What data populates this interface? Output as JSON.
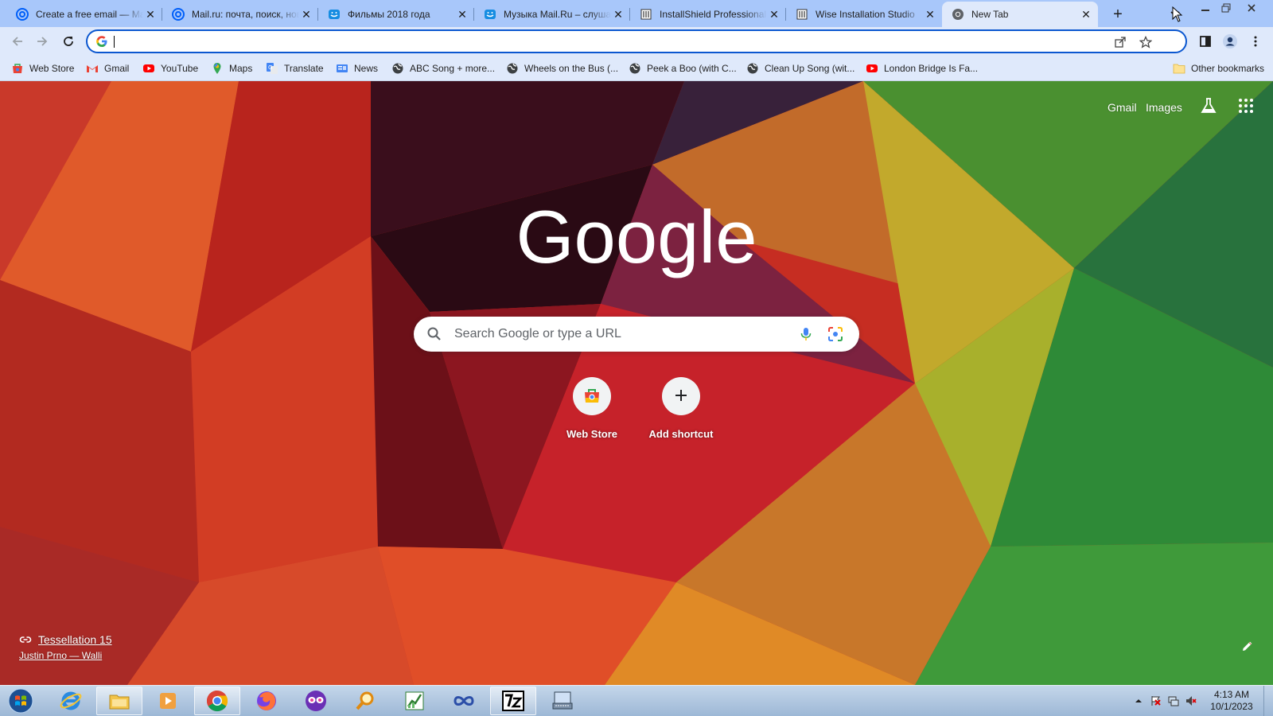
{
  "browser": {
    "tabs": [
      {
        "title": "Create a free email — Mail.ru",
        "favicon": "mailru-at-icon",
        "active": false
      },
      {
        "title": "Mail.ru: почта, поиск, новости",
        "favicon": "mailru-at-icon",
        "active": false
      },
      {
        "title": "Фильмы 2018 года",
        "favicon": "mailru-movies-icon",
        "active": false
      },
      {
        "title": "Музыка Mail.Ru – слушать",
        "favicon": "mailru-music-icon",
        "active": false
      },
      {
        "title": "InstallShield Professional",
        "favicon": "document-icon",
        "active": false
      },
      {
        "title": "Wise Installation Studio",
        "favicon": "document-icon",
        "active": false
      },
      {
        "title": "New Tab",
        "favicon": "chrome-icon",
        "active": true
      }
    ],
    "omnibox": {
      "value": "",
      "placeholder": ""
    },
    "bookmarks": [
      {
        "label": "Web Store",
        "icon": "webstore-icon"
      },
      {
        "label": "Gmail",
        "icon": "gmail-icon"
      },
      {
        "label": "YouTube",
        "icon": "youtube-icon"
      },
      {
        "label": "Maps",
        "icon": "maps-icon"
      },
      {
        "label": "Translate",
        "icon": "translate-icon"
      },
      {
        "label": "News",
        "icon": "news-icon"
      },
      {
        "label": "ABC Song + more...",
        "icon": "globe-icon"
      },
      {
        "label": "Wheels on the Bus (...",
        "icon": "globe-icon"
      },
      {
        "label": "Peek a Boo (with C...",
        "icon": "globe-icon"
      },
      {
        "label": "Clean Up Song (wit...",
        "icon": "globe-icon"
      },
      {
        "label": "London Bridge Is Fa...",
        "icon": "youtube-icon"
      }
    ],
    "other_bookmarks": "Other bookmarks"
  },
  "ntp": {
    "links": {
      "gmail": "Gmail",
      "images": "Images"
    },
    "logo_text": "Google",
    "search_placeholder": "Search Google or type a URL",
    "shortcuts": [
      {
        "label": "Web Store",
        "icon": "webstore-icon"
      },
      {
        "label": "Add shortcut",
        "icon": "plus-icon"
      }
    ],
    "attribution": {
      "title": "Tessellation 15",
      "author": "Justin Prno — Walli"
    }
  },
  "taskbar": {
    "apps": [
      "internet-explorer-icon",
      "file-explorer-icon",
      "media-player-icon",
      "chrome-icon",
      "firefox-icon",
      "mask-app-icon",
      "search-tool-icon",
      "chart-app-icon",
      "infinity-app-icon",
      "7zip-icon",
      "keyboard-app-icon"
    ],
    "clock_time": "4:13 AM",
    "clock_date": "10/1/2023"
  },
  "colors": {
    "tab_strip": "#a8c7fa",
    "toolbar": "#dfe9fb",
    "omnibox_focus": "#0b57d0",
    "accent": "#1a73e8"
  }
}
